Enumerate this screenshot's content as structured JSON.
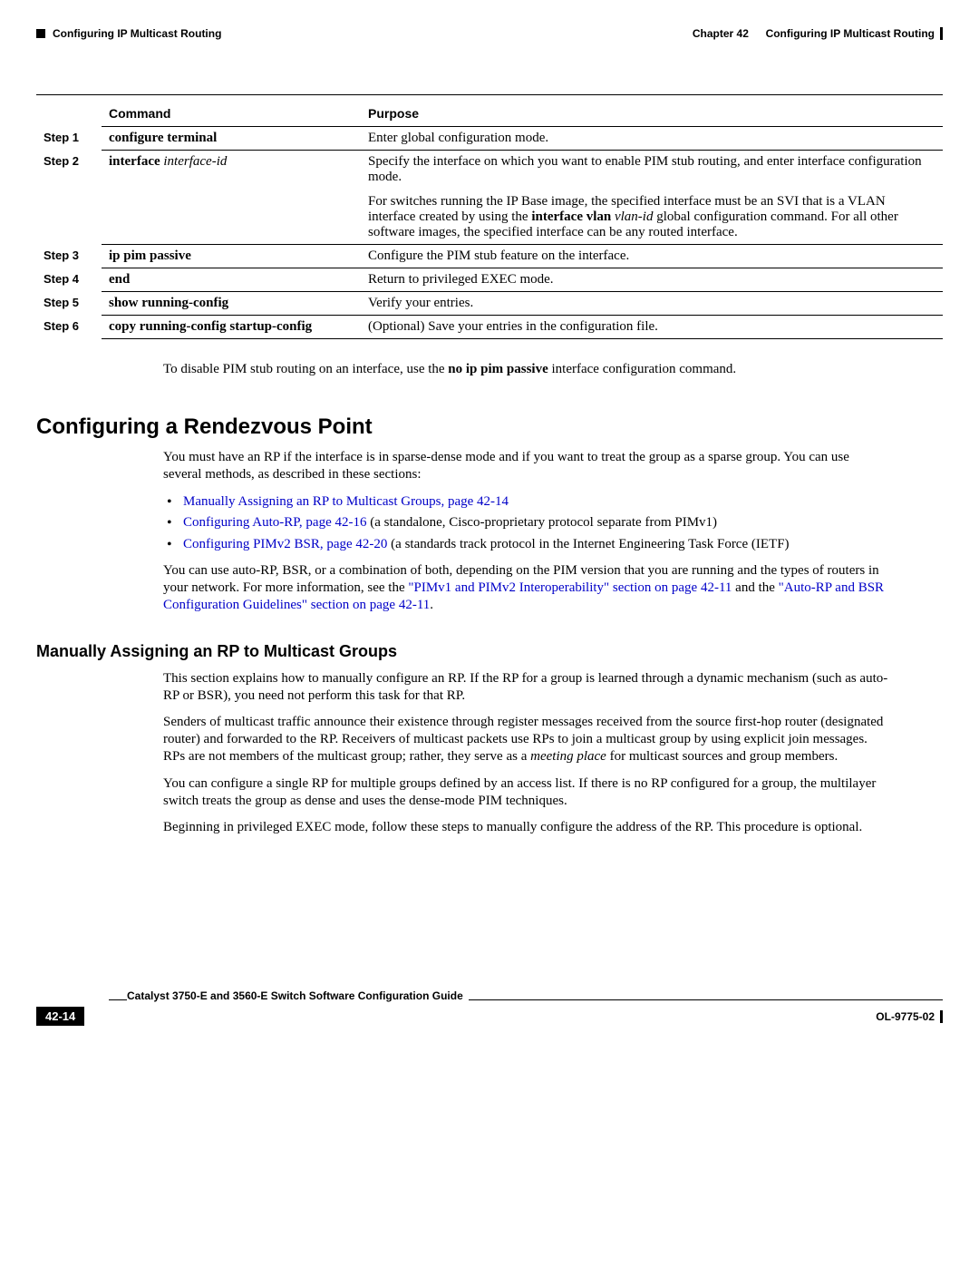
{
  "header": {
    "left": "Configuring IP Multicast Routing",
    "right_chapter": "Chapter 42",
    "right_title": "Configuring IP Multicast Routing"
  },
  "table": {
    "headers": {
      "command": "Command",
      "purpose": "Purpose"
    },
    "rows": [
      {
        "step": "Step 1",
        "command_html": "<b>configure terminal</b>",
        "purpose_html": "<p>Enter global configuration mode.</p>"
      },
      {
        "step": "Step 2",
        "command_html": "<b>interface</b> <span class='arg'>interface-id</span>",
        "purpose_html": "<p>Specify the interface on which you want to enable PIM stub routing, and enter interface configuration mode.</p><p>For switches running the IP Base image, the specified interface must be an SVI that is a VLAN interface created by using the <strong>interface vlan</strong> <em>vlan-id</em> global configuration command. For all other software images, the specified interface can be any routed interface.</p>"
      },
      {
        "step": "Step 3",
        "command_html": "<b>ip pim passive</b>",
        "purpose_html": "<p>Configure the PIM stub feature on the interface.</p>"
      },
      {
        "step": "Step 4",
        "command_html": "<b>end</b>",
        "purpose_html": "<p>Return to privileged EXEC mode.</p>"
      },
      {
        "step": "Step 5",
        "command_html": "<b>show running-config</b>",
        "purpose_html": "<p>Verify your entries.</p>"
      },
      {
        "step": "Step 6",
        "command_html": "<b>copy running-config startup-config</b>",
        "purpose_html": "<p>(Optional) Save your entries in the configuration file.</p>"
      }
    ]
  },
  "disable_note_html": "To disable PIM stub routing on an interface, use the <strong>no ip pim passive</strong> interface configuration command.",
  "section_title": "Configuring a Rendezvous Point",
  "rp_intro": "You must have an RP if the interface is in sparse-dense mode and if you want to treat the group as a sparse group. You can use several methods, as described in these sections:",
  "rp_bullets": [
    "<a class='xref' href='#'>Manually Assigning an RP to Multicast Groups, page 42-14</a>",
    "<a class='xref' href='#'>Configuring Auto-RP, page 42-16</a> (a standalone, Cisco-proprietary protocol separate from PIMv1)",
    "<a class='xref' href='#'>Configuring PIMv2 BSR, page 42-20</a> (a standards track protocol in the Internet Engineering Task Force (IETF)"
  ],
  "rp_followup_html": "You can use auto-RP, BSR, or a combination of both, depending on the PIM version that you are running and the types of routers in your network. For more information, see the <a class='xref' href='#'>\"PIMv1 and PIMv2 Interoperability\" section on page 42-11</a> and the <a class='xref' href='#'>\"Auto-RP and BSR Configuration Guidelines\" section on page 42-11</a>.",
  "subsection_title": "Manually Assigning an RP to Multicast Groups",
  "manual_paragraphs": [
    "This section explains how to manually configure an RP. If the RP for a group is learned through a dynamic mechanism (such as auto-RP or BSR), you need not perform this task for that RP.",
    "Senders of multicast traffic announce their existence through register messages received from the source first-hop router (designated router) and forwarded to the RP. Receivers of multicast packets use RPs to join a multicast group by using explicit join messages. RPs are not members of the multicast group; rather, they serve as a <em>meeting place</em> for multicast sources and group members.",
    "You can configure a single RP for multiple groups defined by an access list. If there is no RP configured for a group, the multilayer switch treats the group as dense and uses the dense-mode PIM techniques.",
    "Beginning in privileged EXEC mode, follow these steps to manually configure the address of the RP. This procedure is optional."
  ],
  "footer": {
    "guide": "Catalyst 3750-E and 3560-E Switch Software Configuration Guide",
    "page": "42-14",
    "docnum": "OL-9775-02"
  }
}
